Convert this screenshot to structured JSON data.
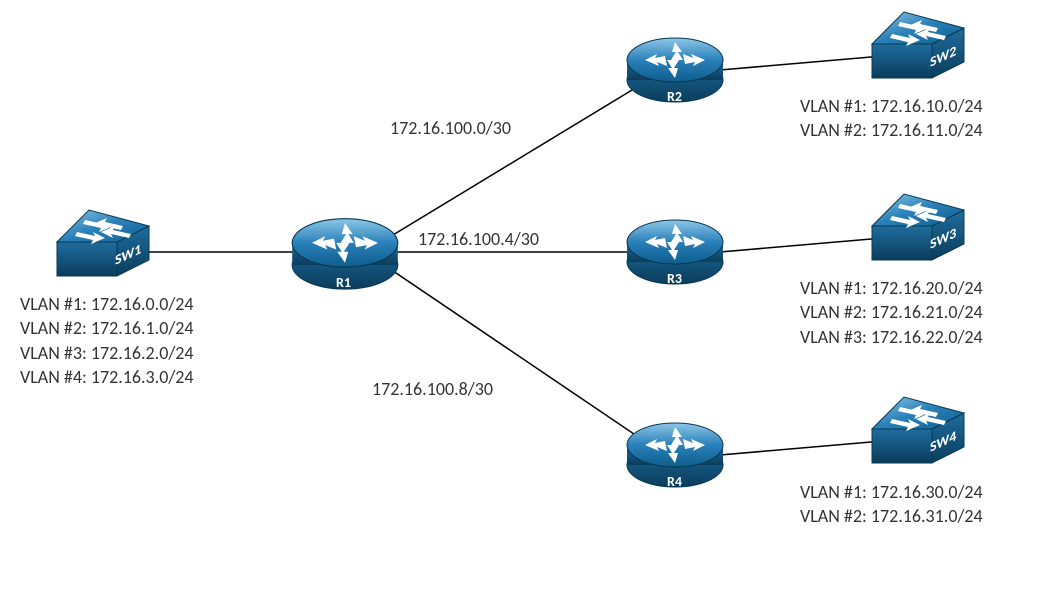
{
  "devices": {
    "R1": {
      "label": "R1"
    },
    "R2": {
      "label": "R2"
    },
    "R3": {
      "label": "R3"
    },
    "R4": {
      "label": "R4"
    },
    "SW1": {
      "label": "SW1"
    },
    "SW2": {
      "label": "SW2"
    },
    "SW3": {
      "label": "SW3"
    },
    "SW4": {
      "label": "SW4"
    }
  },
  "links": {
    "r1_r2": {
      "label": "172.16.100.0/30"
    },
    "r1_r3": {
      "label": "172.16.100.4/30"
    },
    "r1_r4": {
      "label": "172.16.100.8/30"
    }
  },
  "vlan_blocks": {
    "sw1": {
      "lines": [
        "VLAN #1: 172.16.0.0/24",
        "VLAN #2: 172.16.1.0/24",
        "VLAN #3: 172.16.2.0/24",
        "VLAN #4: 172.16.3.0/24"
      ]
    },
    "sw2": {
      "lines": [
        "VLAN #1: 172.16.10.0/24",
        "VLAN #2: 172.16.11.0/24"
      ]
    },
    "sw3": {
      "lines": [
        "VLAN #1: 172.16.20.0/24",
        "VLAN #2: 172.16.21.0/24",
        "VLAN #3: 172.16.22.0/24"
      ]
    },
    "sw4": {
      "lines": [
        "VLAN #1: 172.16.30.0/24",
        "VLAN #2: 172.16.31.0/24"
      ]
    }
  },
  "chart_data": {
    "type": "network-topology",
    "nodes": [
      {
        "id": "R1",
        "type": "router"
      },
      {
        "id": "R2",
        "type": "router"
      },
      {
        "id": "R3",
        "type": "router"
      },
      {
        "id": "R4",
        "type": "router"
      },
      {
        "id": "SW1",
        "type": "switch",
        "vlans": [
          {
            "name": "VLAN #1",
            "subnet": "172.16.0.0/24"
          },
          {
            "name": "VLAN #2",
            "subnet": "172.16.1.0/24"
          },
          {
            "name": "VLAN #3",
            "subnet": "172.16.2.0/24"
          },
          {
            "name": "VLAN #4",
            "subnet": "172.16.3.0/24"
          }
        ]
      },
      {
        "id": "SW2",
        "type": "switch",
        "vlans": [
          {
            "name": "VLAN #1",
            "subnet": "172.16.10.0/24"
          },
          {
            "name": "VLAN #2",
            "subnet": "172.16.11.0/24"
          }
        ]
      },
      {
        "id": "SW3",
        "type": "switch",
        "vlans": [
          {
            "name": "VLAN #1",
            "subnet": "172.16.20.0/24"
          },
          {
            "name": "VLAN #2",
            "subnet": "172.16.21.0/24"
          },
          {
            "name": "VLAN #3",
            "subnet": "172.16.22.0/24"
          }
        ]
      },
      {
        "id": "SW4",
        "type": "switch",
        "vlans": [
          {
            "name": "VLAN #1",
            "subnet": "172.16.30.0/24"
          },
          {
            "name": "VLAN #2",
            "subnet": "172.16.31.0/24"
          }
        ]
      }
    ],
    "edges": [
      {
        "from": "SW1",
        "to": "R1"
      },
      {
        "from": "R1",
        "to": "R2",
        "subnet": "172.16.100.0/30"
      },
      {
        "from": "R1",
        "to": "R3",
        "subnet": "172.16.100.4/30"
      },
      {
        "from": "R1",
        "to": "R4",
        "subnet": "172.16.100.8/30"
      },
      {
        "from": "R2",
        "to": "SW2"
      },
      {
        "from": "R3",
        "to": "SW3"
      },
      {
        "from": "R4",
        "to": "SW4"
      }
    ]
  }
}
